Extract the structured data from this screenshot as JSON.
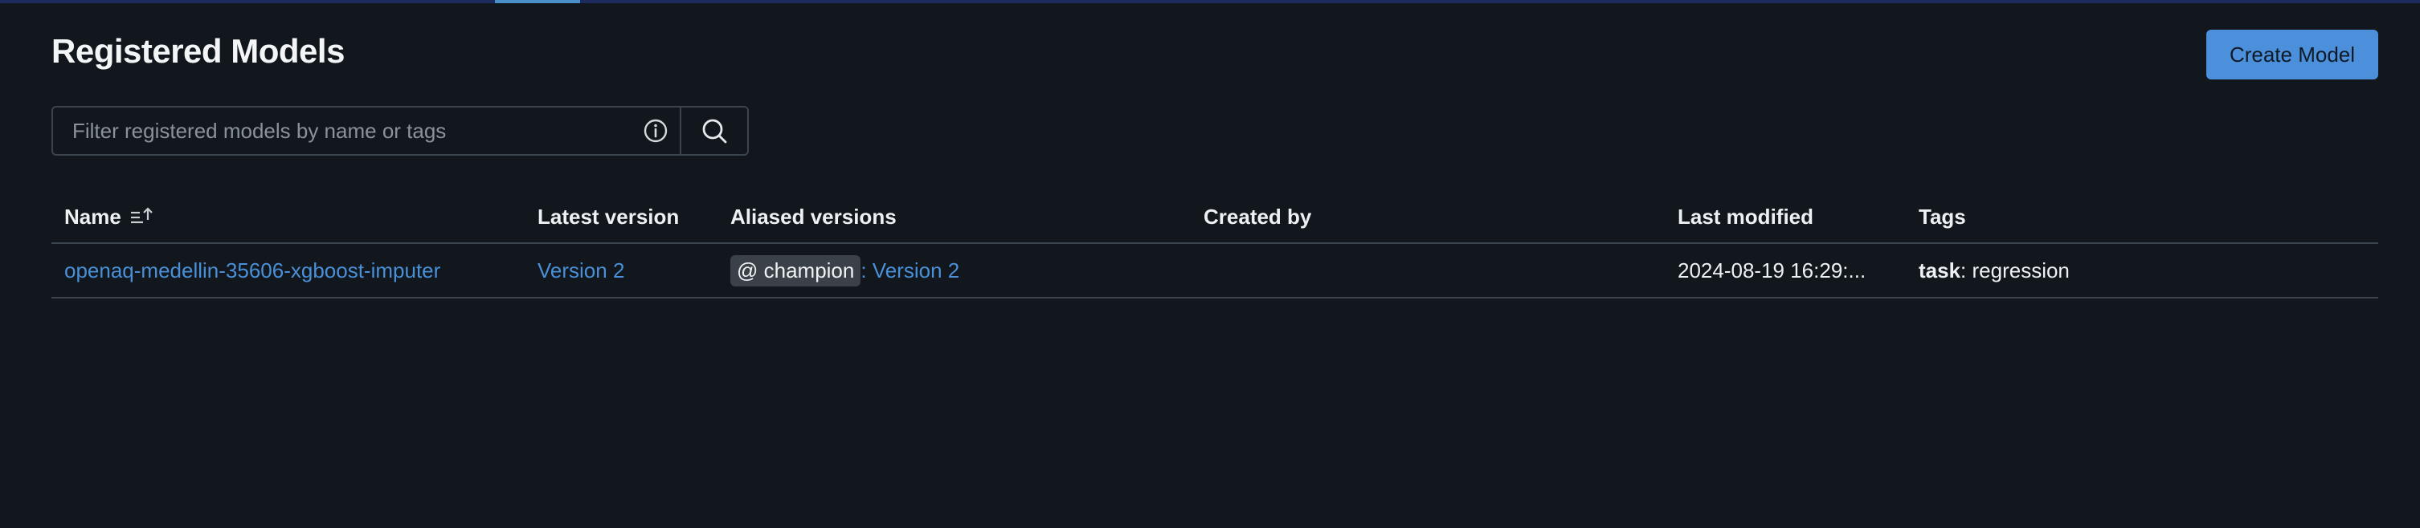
{
  "page": {
    "title": "Registered Models",
    "create_button": "Create Model"
  },
  "search": {
    "placeholder": "Filter registered models by name or tags",
    "value": ""
  },
  "table": {
    "columns": {
      "name": "Name",
      "latest_version": "Latest version",
      "aliased_versions": "Aliased versions",
      "created_by": "Created by",
      "last_modified": "Last modified",
      "tags": "Tags"
    },
    "rows": [
      {
        "name": "openaq-medellin-35606-xgboost-imputer",
        "latest_version": "Version 2",
        "alias_name": "@ champion",
        "alias_version": ": Version 2",
        "created_by": "",
        "last_modified": "2024-08-19 16:29:...",
        "tag_key": "task",
        "tag_value": ": regression"
      }
    ]
  },
  "icons": {
    "sort": "sort-ascending-icon",
    "info": "info-icon",
    "search": "search-icon"
  },
  "colors": {
    "background": "#11171c",
    "accent": "#4c8fdb",
    "link": "#4a90d9",
    "border": "#3b444c"
  }
}
